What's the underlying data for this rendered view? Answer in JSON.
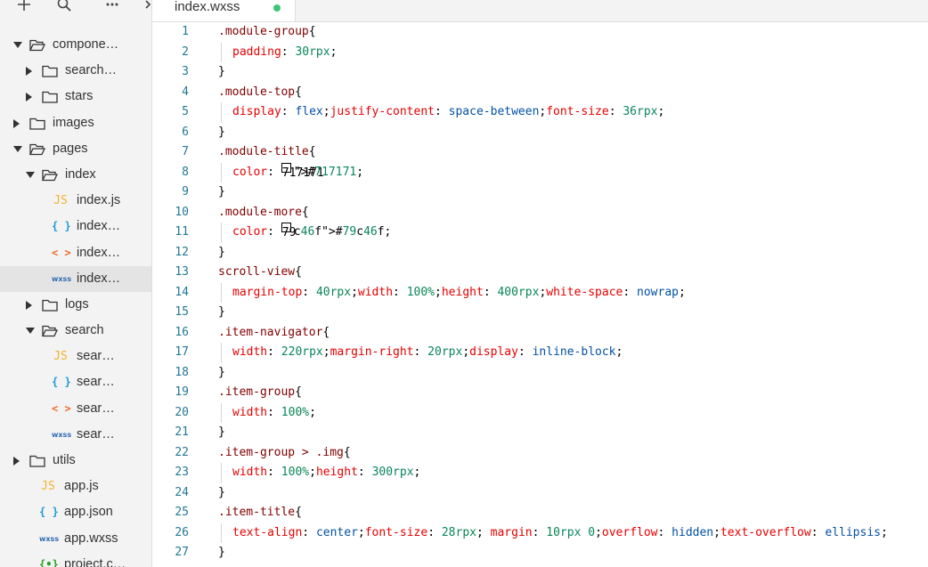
{
  "toolbar": {
    "add_icon": "plus-icon",
    "search_icon": "search-icon",
    "more_icon": "ellipsis-icon",
    "collapse_icon": "collapse-icon"
  },
  "explorer": {
    "items": [
      {
        "label": "compone…",
        "type": "folder",
        "state": "open"
      },
      {
        "label": "search…",
        "type": "folder",
        "state": "closed"
      },
      {
        "label": "stars",
        "type": "folder",
        "state": "closed"
      },
      {
        "label": "images",
        "type": "folder",
        "state": "closed"
      },
      {
        "label": "pages",
        "type": "folder",
        "state": "open"
      },
      {
        "label": "index",
        "type": "folder",
        "state": "open"
      },
      {
        "label": "index.js",
        "type": "js",
        "icon": "JS"
      },
      {
        "label": "index…",
        "type": "json",
        "icon": "{ }"
      },
      {
        "label": "index…",
        "type": "wxml",
        "icon": "< >"
      },
      {
        "label": "index…",
        "type": "wxss",
        "icon": "wxss",
        "selected": true
      },
      {
        "label": "logs",
        "type": "folder",
        "state": "closed"
      },
      {
        "label": "search",
        "type": "folder",
        "state": "open"
      },
      {
        "label": "sear…",
        "type": "js",
        "icon": "JS"
      },
      {
        "label": "sear…",
        "type": "json",
        "icon": "{ }"
      },
      {
        "label": "sear…",
        "type": "wxml",
        "icon": "< >"
      },
      {
        "label": "sear…",
        "type": "wxss",
        "icon": "wxss"
      },
      {
        "label": "utils",
        "type": "folder",
        "state": "closed"
      },
      {
        "label": "app.js",
        "type": "js",
        "icon": "JS"
      },
      {
        "label": "app.json",
        "type": "json",
        "icon": "{ }"
      },
      {
        "label": "app.wxss",
        "type": "wxss",
        "icon": "wxss"
      },
      {
        "label": "project.c…",
        "type": "proj",
        "icon": "{•}"
      }
    ]
  },
  "tabs": [
    {
      "label": "index.wxss",
      "active": true,
      "modified": true
    }
  ],
  "editor": {
    "lines": [
      {
        "n": "1",
        "code": ".module-group{"
      },
      {
        "n": "2",
        "code": "padding: 30rpx;"
      },
      {
        "n": "3",
        "code": "}"
      },
      {
        "n": "4",
        "code": ".module-top{"
      },
      {
        "n": "5",
        "code": "display: flex;justify-content: space-between;font-size: 36rpx;"
      },
      {
        "n": "6",
        "code": "}"
      },
      {
        "n": "7",
        "code": ".module-title{"
      },
      {
        "n": "8",
        "code": "color: #717171;"
      },
      {
        "n": "9",
        "code": "}"
      },
      {
        "n": "10",
        "code": ".module-more{"
      },
      {
        "n": "11",
        "code": "color: #79c46f;"
      },
      {
        "n": "12",
        "code": "}"
      },
      {
        "n": "13",
        "code": "scroll-view{"
      },
      {
        "n": "14",
        "code": "margin-top: 40rpx;width: 100%;height: 400rpx;white-space: nowrap;"
      },
      {
        "n": "15",
        "code": "}"
      },
      {
        "n": "16",
        "code": ".item-navigator{"
      },
      {
        "n": "17",
        "code": "width: 220rpx;margin-right: 20rpx;display: inline-block;"
      },
      {
        "n": "18",
        "code": "}"
      },
      {
        "n": "19",
        "code": ".item-group{"
      },
      {
        "n": "20",
        "code": "width: 100%;"
      },
      {
        "n": "21",
        "code": "}"
      },
      {
        "n": "22",
        "code": ".item-group > .img{"
      },
      {
        "n": "23",
        "code": "width: 100%;height: 300rpx;"
      },
      {
        "n": "24",
        "code": "}"
      },
      {
        "n": "25",
        "code": ".item-title{"
      },
      {
        "n": "26",
        "code": "text-align: center;font-size: 28rpx; margin: 10rpx 0;overflow: hidden;text-overflow: ellipsis;"
      },
      {
        "n": "27",
        "code": "}"
      }
    ]
  },
  "colors": {
    "modified_dot": "#3dc57a",
    "swatch_title": "#717171",
    "swatch_more": "#79c46f"
  }
}
